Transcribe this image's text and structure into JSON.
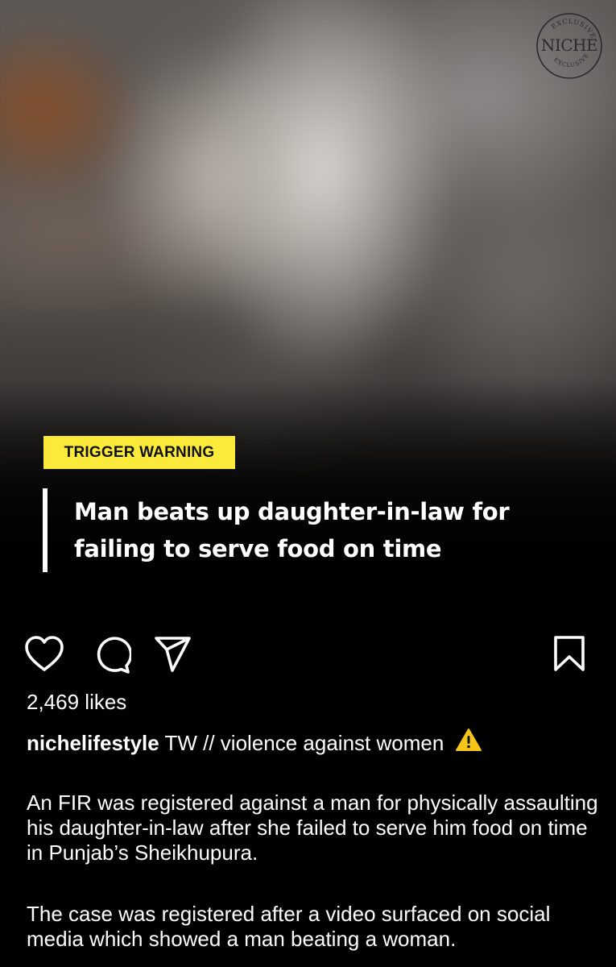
{
  "post": {
    "image": {
      "description_icon": "blurred-photo",
      "trigger_label": "TRIGGER WARNING",
      "headline": "Man beats up daughter-in-law for failing to serve food on time",
      "headline_lines": [
        "Man beats up daughter-in-law for",
        "failing to serve food on time"
      ],
      "logo": {
        "brand": "NICHE",
        "top_text": "EXCLUSIVE",
        "bottom_text": "EXCLUSIVE"
      },
      "badge_color": "#fbea3a"
    },
    "actions": {
      "like_icon": "heart-icon",
      "comment_icon": "comment-icon",
      "share_icon": "paper-plane-icon",
      "save_icon": "bookmark-icon"
    },
    "likes_text": "2,469 likes",
    "caption": {
      "username": "nichelifestyle",
      "text": " TW // violence against women ",
      "emoji": "⚠️",
      "paragraphs": [
        "An FIR was registered against a man for physically assaulting his daughter-in-law after she failed to serve him food on time in Punjab’s Sheikhupura.",
        "The case was registered after a video surfaced on social media which showed a man beating a woman."
      ]
    }
  }
}
